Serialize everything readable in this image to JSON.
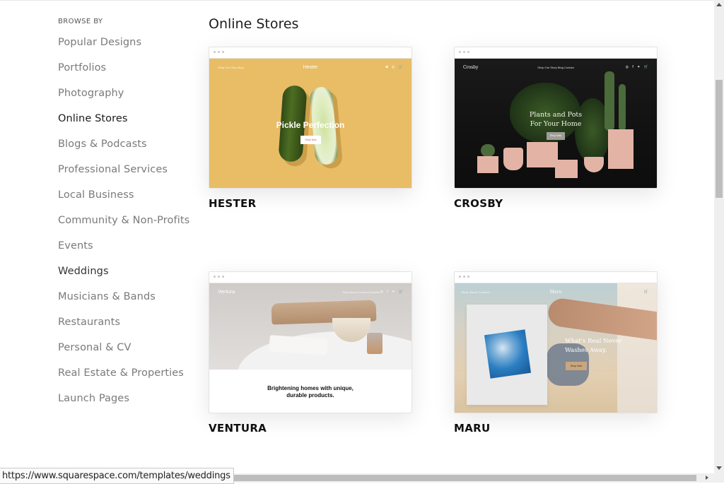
{
  "sidebar": {
    "heading": "BROWSE BY",
    "items": [
      {
        "label": "Popular Designs"
      },
      {
        "label": "Portfolios"
      },
      {
        "label": "Photography"
      },
      {
        "label": "Online Stores",
        "active": true
      },
      {
        "label": "Blogs & Podcasts"
      },
      {
        "label": "Professional Services"
      },
      {
        "label": "Local Business"
      },
      {
        "label": "Community & Non-Profits"
      },
      {
        "label": "Events"
      },
      {
        "label": "Weddings",
        "hovered": true
      },
      {
        "label": "Musicians & Bands"
      },
      {
        "label": "Restaurants"
      },
      {
        "label": "Personal & CV"
      },
      {
        "label": "Real Estate & Properties"
      },
      {
        "label": "Launch Pages"
      }
    ]
  },
  "main": {
    "section_title": "Online Stores",
    "templates": [
      {
        "name": "HESTER",
        "preview": {
          "site_logo": "Hester",
          "nav": "Shop  Our Story  Blog",
          "hero": "Pickle Perfection",
          "button": "Shop Now",
          "icons": "◙ ◎ 🛒",
          "bg_color": "#e8bd66"
        }
      },
      {
        "name": "CROSBY",
        "preview": {
          "site_logo": "Crosby",
          "nav": "Shop  Our Story  Blog  Contact",
          "hero_line1": "Plants and Pots",
          "hero_line2": "For Your Home",
          "button": "Shop Now",
          "icons": "◎ f ✦ 🛒",
          "bg_color": "#141414"
        }
      },
      {
        "name": "VENTURA",
        "preview": {
          "site_logo": "Ventura",
          "nav": "Shop  About  Contact  Stockists",
          "icons": "◎ f ✦ 🛒",
          "tagline_line1": "Brightening homes with unique,",
          "tagline_line2": "durable products."
        }
      },
      {
        "name": "MARU",
        "preview": {
          "site_logo": "Maru",
          "nav": "Shop  About  Contact",
          "hero_line1": "What's Real Never",
          "hero_line2": "Washes Away.",
          "button": "Shop Now",
          "icons": "🛒"
        }
      }
    ]
  },
  "status_bar": {
    "url": "https://www.squarespace.com/templates/weddings"
  }
}
